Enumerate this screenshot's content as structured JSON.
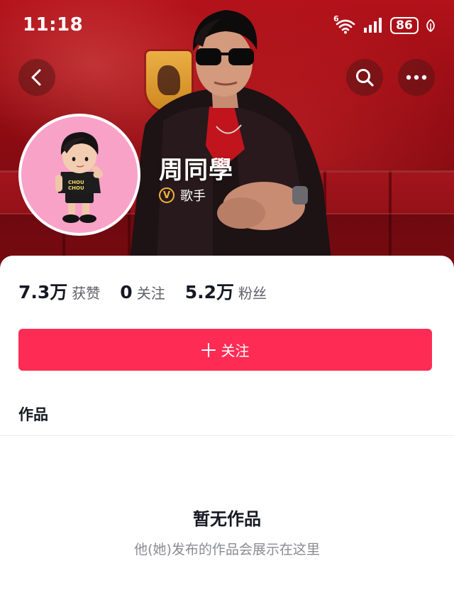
{
  "status_bar": {
    "time": "11:18",
    "network": "6",
    "battery": "86"
  },
  "nav": {
    "back_icon": "chevron-left-icon",
    "search_icon": "search-icon",
    "more_icon": "more-dots-icon"
  },
  "profile": {
    "name": "周同學",
    "verified_badge": "V",
    "verified_label": "歌手"
  },
  "stats": [
    {
      "value": "7.3万",
      "label": "获赞"
    },
    {
      "value": "0",
      "label": "关注"
    },
    {
      "value": "5.2万",
      "label": "粉丝"
    }
  ],
  "follow_button": {
    "label": "关注"
  },
  "tabs": {
    "works": "作品"
  },
  "empty_state": {
    "title": "暂无作品",
    "subtitle": "他(她)发布的作品会展示在这里"
  },
  "colors": {
    "accent": "#fe2c55",
    "banner": "#b3121a",
    "verify_gold": "#f3b43c",
    "avatar_bg": "#f9a2c8"
  }
}
